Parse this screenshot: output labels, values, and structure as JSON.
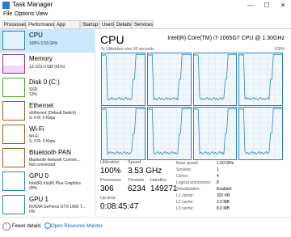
{
  "window": {
    "title": "Task Manager",
    "minimize": "—",
    "maximize": "☐",
    "close": "✕"
  },
  "menu": [
    "File",
    "Options",
    "View"
  ],
  "tabs": [
    "Processes",
    "Performance",
    "App history",
    "Startup",
    "Users",
    "Details",
    "Services"
  ],
  "active_tab": "Performance",
  "sidebar": [
    {
      "name": "CPU",
      "sub": "100% 3.53 GHz",
      "color": "#2a86c0",
      "level": 1.0
    },
    {
      "name": "Memory",
      "sub": "13.1/31.6 GB (41%)",
      "color": "#8b2fa6",
      "level": 0.41
    },
    {
      "name": "Disk 0 (C:)",
      "sub": [
        "SSD",
        "13%"
      ],
      "color": "#4da832",
      "level": 0.13
    },
    {
      "name": "Ethernet",
      "sub": [
        "vEthernet (Default Switch)",
        "S: 0 R: 0 Kbps"
      ],
      "color": "#a75b1f",
      "level": 0.2
    },
    {
      "name": "Wi-Fi",
      "sub": [
        "Wi-Fi",
        "S: 0 R: 0 Kbps"
      ],
      "color": "#a75b1f",
      "level": 0.0
    },
    {
      "name": "Bluetooth PAN",
      "sub": [
        "Bluetooth Network Connec...",
        "Not connected"
      ],
      "color": "#a75b1f",
      "level": 0.0
    },
    {
      "name": "GPU 0",
      "sub": [
        "Intel(R) Iris(R) Plus Graphics",
        "20%"
      ],
      "color": "#2a86c0",
      "level": 0.2
    },
    {
      "name": "GPU 1",
      "sub": [
        "NVIDIA GeForce GTX 1660 T...",
        "0%"
      ],
      "color": "#2a86c0",
      "level": 0.0
    }
  ],
  "main": {
    "title": "CPU",
    "model": "Intel(R) Core(TM) i7-1065G7 CPU @ 1.30GHz",
    "util_label": "% Utilization over 60 seconds",
    "util_max": "100%",
    "stats": {
      "utilization_label": "Utilization",
      "utilization": "100%",
      "speed_label": "Speed",
      "speed": "3.53 GHz",
      "processes_label": "Processes",
      "processes": "306",
      "threads_label": "Threads",
      "threads": "6234",
      "handles_label": "Handles",
      "handles": "149271",
      "uptime_label": "Up time",
      "uptime": "0:08:45:47"
    },
    "details": [
      {
        "label": "Base speed:",
        "value": "1.50 GHz"
      },
      {
        "label": "Sockets:",
        "value": "1"
      },
      {
        "label": "Cores:",
        "value": "4"
      },
      {
        "label": "Logical processors:",
        "value": "8"
      },
      {
        "label": "Virtualization:",
        "value": "Enabled"
      },
      {
        "label": "L1 cache:",
        "value": "320 KB"
      },
      {
        "label": "L2 cache:",
        "value": "2.0 MB"
      },
      {
        "label": "L3 cache:",
        "value": "8.0 MB"
      }
    ]
  },
  "footer": {
    "fewer": "Fewer details",
    "resource_monitor": "Open Resource Monitor"
  }
}
